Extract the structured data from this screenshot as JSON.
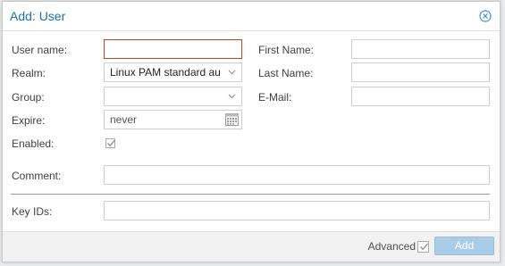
{
  "dialog": {
    "title": "Add: User",
    "close_icon": "close-circle-icon"
  },
  "form": {
    "username": {
      "label": "User name:",
      "value": ""
    },
    "realm": {
      "label": "Realm:",
      "value": "Linux PAM standard authentication",
      "icon": "chevron-down-icon"
    },
    "group": {
      "label": "Group:",
      "value": "",
      "icon": "chevron-down-icon"
    },
    "expire": {
      "label": "Expire:",
      "placeholder": "never",
      "icon": "calendar-icon"
    },
    "enabled": {
      "label": "Enabled:",
      "checked": true
    },
    "first_name": {
      "label": "First Name:",
      "value": ""
    },
    "last_name": {
      "label": "Last Name:",
      "value": ""
    },
    "email": {
      "label": "E-Mail:",
      "value": ""
    },
    "comment": {
      "label": "Comment:",
      "value": ""
    },
    "key_ids": {
      "label": "Key IDs:",
      "value": ""
    }
  },
  "footer": {
    "advanced_label": "Advanced",
    "advanced_checked": true,
    "add_label": "Add"
  },
  "colors": {
    "title": "#1a6fb0",
    "focus_border": "#b04a2d",
    "add_button": "#a9cce9"
  }
}
